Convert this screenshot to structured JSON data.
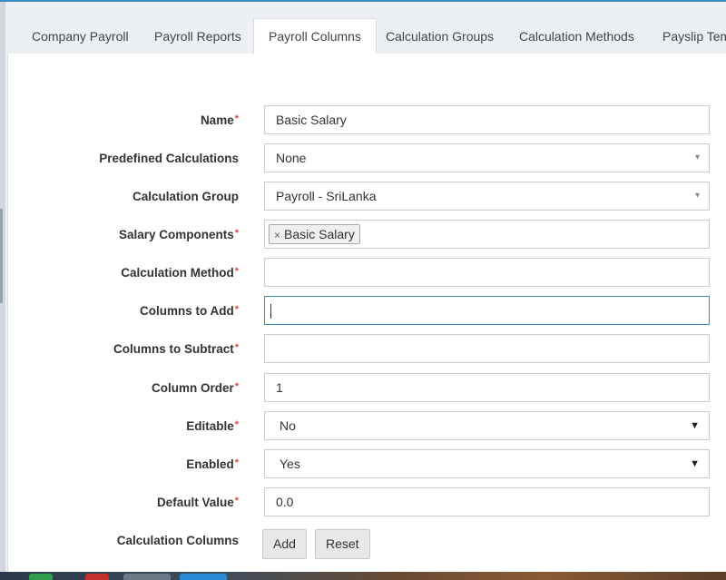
{
  "tabs": [
    {
      "label": "Company Payroll"
    },
    {
      "label": "Payroll Reports"
    },
    {
      "label": "Payroll Columns"
    },
    {
      "label": "Calculation Groups"
    },
    {
      "label": "Calculation Methods"
    },
    {
      "label": "Payslip Tem"
    }
  ],
  "form": {
    "name": {
      "label": "Name",
      "value": "Basic Salary"
    },
    "predefined_calculations": {
      "label": "Predefined Calculations",
      "value": "None"
    },
    "calculation_group": {
      "label": "Calculation Group",
      "value": "Payroll - SriLanka"
    },
    "salary_components": {
      "label": "Salary Components",
      "chip": "Basic Salary",
      "remove": "×"
    },
    "calculation_method": {
      "label": "Calculation Method",
      "value": ""
    },
    "columns_to_add": {
      "label": "Columns to Add",
      "value": ""
    },
    "columns_to_subtract": {
      "label": "Columns to Subtract",
      "value": ""
    },
    "column_order": {
      "label": "Column Order",
      "value": "1"
    },
    "editable": {
      "label": "Editable",
      "value": "No"
    },
    "enabled": {
      "label": "Enabled",
      "value": "Yes"
    },
    "default_value": {
      "label": "Default Value",
      "value": "0.0"
    },
    "calculation_columns": {
      "label": "Calculation Columns",
      "add_label": "Add",
      "reset_label": "Reset"
    },
    "required_mark": "*"
  },
  "icons": {
    "dropdown_caret": "▾",
    "select_caret": "▼"
  },
  "colors": {
    "accent": "#3c8dbc",
    "required": "#dd4b39"
  }
}
